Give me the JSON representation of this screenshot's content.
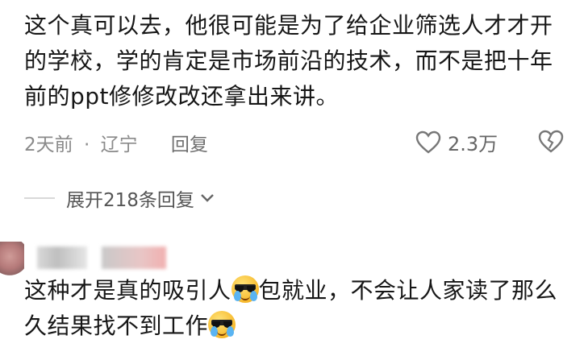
{
  "comment1": {
    "text": "这个真可以去，他很可能是为了给企业筛选人才才开的学校，学的肯定是市场前沿的技术，而不是把十年前的ppt修修改改还拿出来讲。",
    "time": "2天前",
    "separator": "·",
    "location": "辽宁",
    "reply_label": "回复",
    "likes": "2.3万"
  },
  "expand": {
    "label": "展开218条回复"
  },
  "comment2": {
    "text_part1": "这种才是真的吸引人",
    "text_part2": "包就业，不会让人家读了那么久结果找不到工作",
    "emoji": "sunglasses-crying-emoji"
  },
  "icons": {
    "like": "heart-outline-icon",
    "dislike": "broken-heart-icon",
    "expand": "chevron-down-icon"
  }
}
